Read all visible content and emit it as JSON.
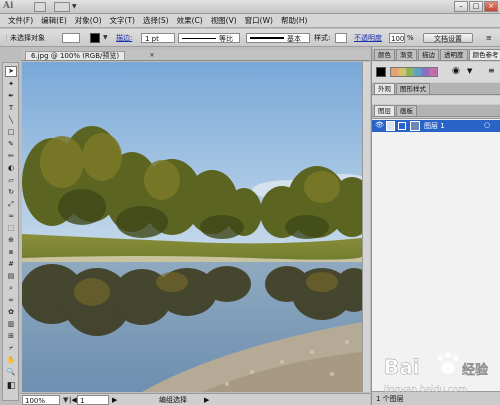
{
  "titlebar": {
    "logo": "Ai"
  },
  "menu": [
    "文件(F)",
    "编辑(E)",
    "对象(O)",
    "文字(T)",
    "选择(S)",
    "效果(C)",
    "视图(V)",
    "窗口(W)",
    "帮助(H)"
  ],
  "control_bar": {
    "selection_label": "未选择对象",
    "stroke_label": "描边:",
    "stroke_weight": "1 pt",
    "profile_label": "等比",
    "brush_label": "基本",
    "style_label": "样式:",
    "opacity_label": "不透明度",
    "opacity_value": "100",
    "opacity_unit": "%",
    "doc_settings_button": "文档设置"
  },
  "document": {
    "tab_label": "6.jpg @ 100% (RGB/预览)",
    "tab_close": "×"
  },
  "status_bar": {
    "zoom": "100%",
    "artboard": "1",
    "status_text": "编组选择"
  },
  "panels": {
    "top_tabs": [
      "颜色",
      "渐变",
      "描边",
      "透明度",
      "颜色参考"
    ],
    "appearance_tabs": [
      "外观",
      "图形样式"
    ],
    "layers_tabs": [
      "图层",
      "画板"
    ],
    "layer_name": "图层 1",
    "layer_count": "1 个图层"
  },
  "watermark": {
    "brand": "Bai",
    "brand_cn": "经验",
    "url": "jingyan.baidu.com"
  },
  "colors": {
    "accent": "#2a63c8",
    "link": "#1a2fb0"
  }
}
